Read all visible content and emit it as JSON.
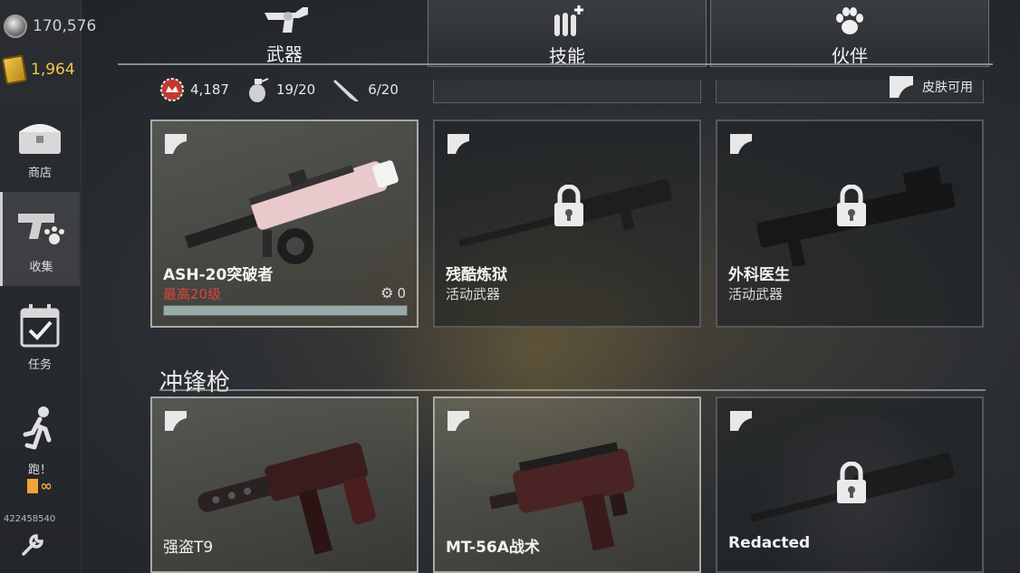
{
  "currencies": {
    "silver": "170,576",
    "gold": "1,964"
  },
  "sidebar": {
    "items": [
      {
        "label": "商店",
        "icon": "chest-icon"
      },
      {
        "label": "收集",
        "icon": "gun-paw-icon"
      },
      {
        "label": "任务",
        "icon": "calendar-check-icon"
      },
      {
        "label": "跑！",
        "icon": "runner-icon",
        "energy": "∞"
      }
    ],
    "player_id": "422458540"
  },
  "tabs": [
    {
      "label": "武器",
      "icon": "revolver-icon",
      "active": true
    },
    {
      "label": "技能",
      "icon": "bullets-plus-icon",
      "active": false
    },
    {
      "label": "伙伴",
      "icon": "paw-icon",
      "active": false
    }
  ],
  "stats": {
    "cap_count": "4,187",
    "grenade": "19/20",
    "melee": "6/20"
  },
  "skin_available": "皮肤可用",
  "cards_row1": [
    {
      "name": "ASH-20突破者",
      "sub": "最高20级",
      "sub_red": true,
      "gear": "0",
      "owned": true,
      "progress": 1.0
    },
    {
      "name": "残酷炼狱",
      "sub": "活动武器",
      "locked": true
    },
    {
      "name": "外科医生",
      "sub": "活动武器",
      "locked": true
    }
  ],
  "section": {
    "title": "冲锋枪"
  },
  "cards_row2": [
    {
      "name": "强盗T9",
      "owned": true
    },
    {
      "name": "MT-56A战术",
      "owned": true
    },
    {
      "name": "Redacted",
      "locked": true
    }
  ],
  "colors": {
    "accent_red": "#e0433c",
    "gold": "#f2c84b"
  }
}
